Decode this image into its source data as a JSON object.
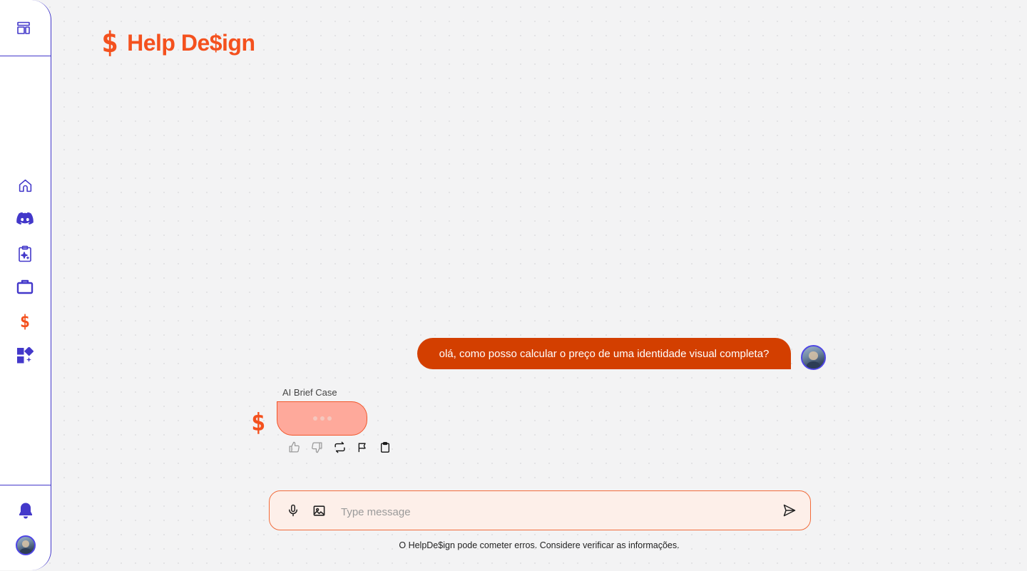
{
  "brand": {
    "mark": "$",
    "name": "Help De$ign"
  },
  "sidebar": {
    "top_icon": "layout-icon",
    "nav": [
      {
        "icon": "home-icon"
      },
      {
        "icon": "discord-icon"
      },
      {
        "icon": "clipboard-sparkle-icon"
      },
      {
        "icon": "briefcase-icon"
      },
      {
        "icon": "dollar-icon",
        "glyph": "$"
      },
      {
        "icon": "apps-icon"
      }
    ],
    "bottom": [
      {
        "icon": "bell-icon"
      },
      {
        "icon": "avatar"
      }
    ]
  },
  "chat": {
    "user_message": "olá, como posso calcular o preço de uma identidade visual completa?",
    "assistant_name": "AI Brief Case",
    "assistant_mark": "$",
    "assistant_status": "typing",
    "actions": [
      "thumbs-up-icon",
      "thumbs-down-icon",
      "regenerate-icon",
      "flag-icon",
      "copy-icon"
    ]
  },
  "composer": {
    "placeholder": "Type message",
    "value": ""
  },
  "disclaimer": "O HelpDe$ign pode cometer erros. Considere verificar as informações.",
  "colors": {
    "accent": "#f4511e",
    "user_bubble": "#d33f00",
    "assistant_bubble": "#fea99b",
    "nav_primary": "#4338ca",
    "composer_bg": "#fdefe9"
  }
}
